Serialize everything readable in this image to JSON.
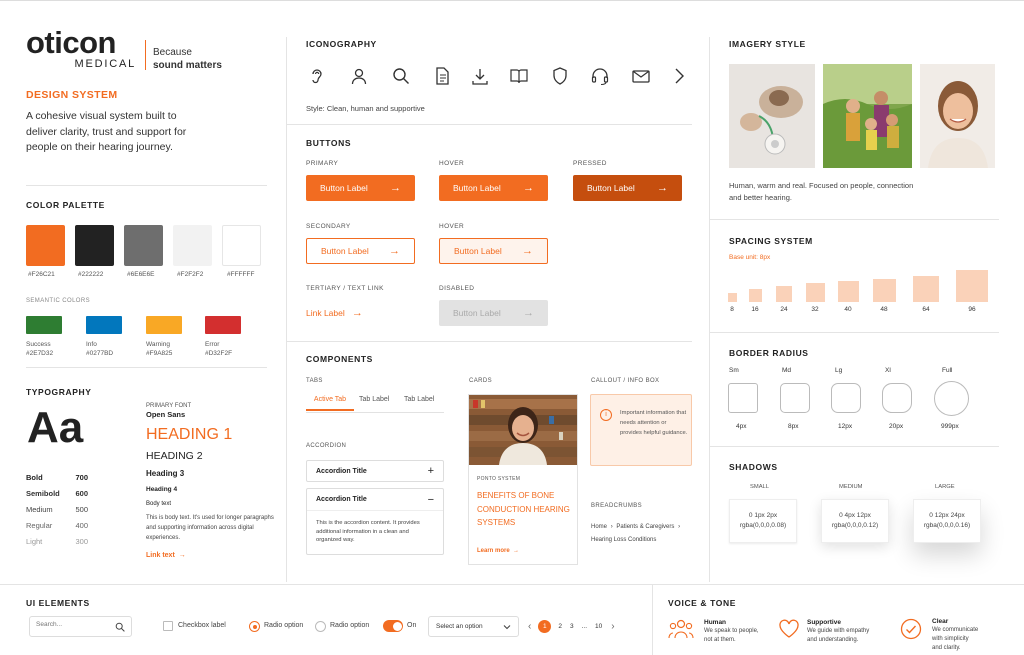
{
  "brand": {
    "name": "oticon",
    "sub": "MEDICAL",
    "tag1": "Because",
    "tag2": "sound matters"
  },
  "design_system": {
    "title": "DESIGN SYSTEM",
    "desc": "A cohesive visual system built to deliver clarity, trust and support for people on their hearing journey."
  },
  "palette": {
    "title": "COLOR PALETTE",
    "colors": [
      {
        "hex": "#F26C21"
      },
      {
        "hex": "#222222"
      },
      {
        "hex": "#6E6E6E"
      },
      {
        "hex": "#F2F2F2"
      },
      {
        "hex": "#FFFFFF"
      }
    ],
    "semantic_title": "SEMANTIC COLORS",
    "semantic": [
      {
        "name": "Success",
        "hex": "#2E7D32"
      },
      {
        "name": "Info",
        "hex": "#0277BD"
      },
      {
        "name": "Warning",
        "hex": "#F9A825"
      },
      {
        "name": "Error",
        "hex": "#D32F2F"
      }
    ]
  },
  "typography": {
    "title": "TYPOGRAPHY",
    "sample": "Aa",
    "weights": [
      {
        "name": "Bold",
        "value": "700"
      },
      {
        "name": "Semibold",
        "value": "600"
      },
      {
        "name": "Medium",
        "value": "500"
      },
      {
        "name": "Regular",
        "value": "400"
      },
      {
        "name": "Light",
        "value": "300"
      }
    ],
    "font_label": "PRIMARY FONT",
    "font_name": "Open Sans",
    "h1": "HEADING 1",
    "h2": "HEADING 2",
    "h3": "Heading 3",
    "h4": "Heading 4",
    "body_label": "Body text",
    "body": "This is body text. It's used for longer paragraphs and supporting information across digital experiences.",
    "link": "Link text",
    "link_arrow": "→"
  },
  "iconography": {
    "title": "ICONOGRAPHY",
    "style": "Style: Clean, human and supportive"
  },
  "buttons": {
    "title": "BUTTONS",
    "primary": "PRIMARY",
    "hover": "HOVER",
    "pressed": "PRESSED",
    "secondary": "SECONDARY",
    "hover2": "HOVER",
    "tertiary": "TERTIARY / TEXT LINK",
    "disabled": "DISABLED",
    "label": "Button Label",
    "link_label": "Link Label",
    "arrow": "→"
  },
  "components": {
    "title": "COMPONENTS",
    "tabs_label": "TABS",
    "tabs": [
      "Active Tab",
      "Tab Label",
      "Tab Label"
    ],
    "accordion_label": "ACCORDION",
    "acc1": "Accordion Title",
    "acc1_icon": "+",
    "acc2": "Accordion Title",
    "acc2_icon": "−",
    "acc_body": "This is the accordion content. It provides additional information in a clean and organized way.",
    "cards_label": "CARDS",
    "card_tag": "PONTO SYSTEM",
    "card_title": "BENEFITS OF BONE CONDUCTION HEARING SYSTEMS",
    "card_link": "Learn more",
    "card_arrow": "→",
    "callout_label": "CALLOUT / INFO BOX",
    "callout_icon": "i",
    "callout": "Important information that needs attention or provides helpful guidance.",
    "breadcrumbs_label": "BREADCRUMBS",
    "crumb1": "Home",
    "crumb2": "Patients & Caregivers",
    "crumb3": "Hearing Loss Conditions",
    "crumb_sep": "›"
  },
  "imagery": {
    "title": "IMAGERY STYLE",
    "desc": "Human, warm and real. Focused on people, connection and better hearing."
  },
  "spacing": {
    "title": "SPACING SYSTEM",
    "base": "Base unit: 8px",
    "values": [
      8,
      16,
      24,
      32,
      40,
      48,
      64,
      96
    ]
  },
  "radius": {
    "title": "BORDER RADIUS",
    "items": [
      {
        "name": "Sm",
        "value": "4px"
      },
      {
        "name": "Md",
        "value": "8px"
      },
      {
        "name": "Lg",
        "value": "12px"
      },
      {
        "name": "Xl",
        "value": "20px"
      },
      {
        "name": "Full",
        "value": "999px"
      }
    ]
  },
  "shadows": {
    "title": "SHADOWS",
    "items": [
      {
        "name": "SMALL",
        "l1": "0 1px 2px",
        "l2": "rgba(0,0,0,0.08)"
      },
      {
        "name": "MEDIUM",
        "l1": "0 4px 12px",
        "l2": "rgba(0,0,0,0.12)"
      },
      {
        "name": "LARGE",
        "l1": "0 12px 24px",
        "l2": "rgba(0,0,0,0.16)"
      }
    ]
  },
  "ui": {
    "title": "UI ELEMENTS",
    "search_placeholder": "Search...",
    "checkbox": "Checkbox label",
    "radio1": "Radio option",
    "radio2": "Radio option",
    "toggle": "On",
    "select": "Select an option",
    "pages": [
      "1",
      "2",
      "3",
      "...",
      "10"
    ],
    "prev": "‹",
    "next": "›"
  },
  "voice": {
    "title": "VOICE & TONE",
    "items": [
      {
        "title": "Human",
        "l1": "We speak to people,",
        "l2": "not at them."
      },
      {
        "title": "Supportive",
        "l1": "We guide with empathy",
        "l2": "and understanding."
      },
      {
        "title": "Clear",
        "l1": "We communicate",
        "l2": "with simplicity",
        "l3": "and clarity."
      }
    ]
  }
}
